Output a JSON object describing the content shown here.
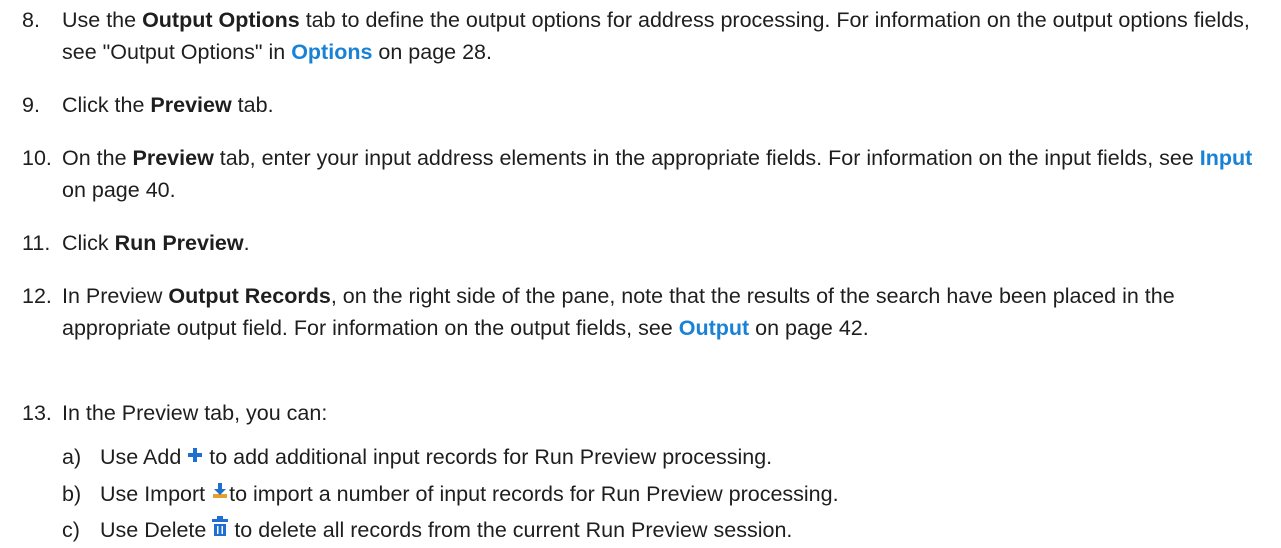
{
  "steps": [
    {
      "num": "8.",
      "p1": "Use the ",
      "b1": "Output Options",
      "p2": " tab to define the output options for address processing. For information on the output options fields, see \"Output Options\" in ",
      "link": "Options",
      "p3": " on page 28."
    },
    {
      "num": "9.",
      "p1": "Click the ",
      "b1": "Preview",
      "p2": " tab."
    },
    {
      "num": "10.",
      "p1": "On the ",
      "b1": "Preview",
      "p2": " tab, enter your input address elements in the appropriate fields. For information on the input fields, see ",
      "link": "Input",
      "p3": " on page 40."
    },
    {
      "num": "11.",
      "p1": "Click ",
      "b1": "Run Preview",
      "p2": "."
    },
    {
      "num": "12.",
      "p1": "In Preview ",
      "b1": "Output Records",
      "p2": ", on the right side of the pane, note that the results of the search have been placed in the appropriate output field. For information on the output fields, see ",
      "link": "Output",
      "p3": " on page 42."
    },
    {
      "num": "13.",
      "p1": "In the Preview tab, you can:"
    }
  ],
  "substeps": [
    {
      "letter": "a)",
      "pre": "Use Add",
      "icon": "plus-icon",
      "post": " to add additional input records for Run Preview processing."
    },
    {
      "letter": "b)",
      "pre": "Use Import",
      "icon": "import-icon",
      "post": "to import a number of input records for Run Preview processing."
    },
    {
      "letter": "c)",
      "pre": "Use Delete",
      "icon": "trash-icon",
      "post": " to delete all records from the current Run Preview session."
    }
  ],
  "colors": {
    "link": "#1a82d6",
    "icon": "#1f6fd0"
  }
}
